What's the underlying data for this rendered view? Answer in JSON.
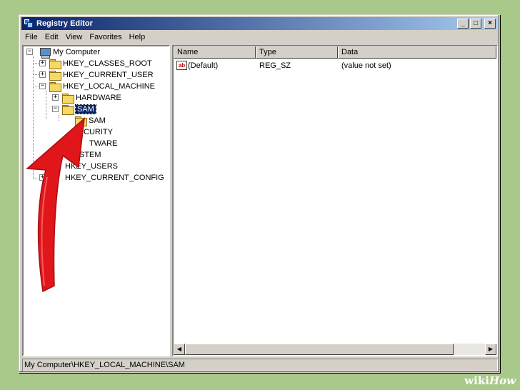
{
  "window": {
    "title": "Registry Editor",
    "minimize_glyph": "_",
    "maximize_glyph": "□",
    "close_glyph": "×"
  },
  "menu": [
    "File",
    "Edit",
    "View",
    "Favorites",
    "Help"
  ],
  "tree": {
    "root": "My Computer",
    "items": [
      {
        "label": "HKEY_CLASSES_ROOT",
        "expander": "+"
      },
      {
        "label": "HKEY_CURRENT_USER",
        "expander": "+"
      },
      {
        "label": "HKEY_LOCAL_MACHINE",
        "expander": "−"
      },
      {
        "label": "HARDWARE",
        "expander": "+"
      },
      {
        "label": "SAM",
        "expander": "−",
        "selected": true
      },
      {
        "label": "SAM",
        "expander": ""
      },
      {
        "label": "CURITY",
        "expander": "+"
      },
      {
        "label": "TWARE",
        "expander": "+"
      },
      {
        "label": "STEM",
        "expander": "+"
      },
      {
        "label": "HKEY_USERS",
        "expander": "+"
      },
      {
        "label": "HKEY_CURRENT_CONFIG",
        "expander": "+"
      }
    ],
    "root_expander": "−"
  },
  "list": {
    "columns": [
      "Name",
      "Type",
      "Data"
    ],
    "rows": [
      {
        "icon": "string-value-icon",
        "icon_text": "ab",
        "name": "(Default)",
        "type": "REG_SZ",
        "data": "(value not set)"
      }
    ]
  },
  "scrollbar": {
    "left_arrow": "◀",
    "right_arrow": "▶"
  },
  "status": "My Computer\\HKEY_LOCAL_MACHINE\\SAM",
  "watermark": {
    "wiki": "wiki",
    "how": "How"
  },
  "colors": {
    "titlebar": "#0a246a",
    "selection": "#0a246a",
    "arrow": "#e0161b",
    "background": "#a9c98a"
  }
}
